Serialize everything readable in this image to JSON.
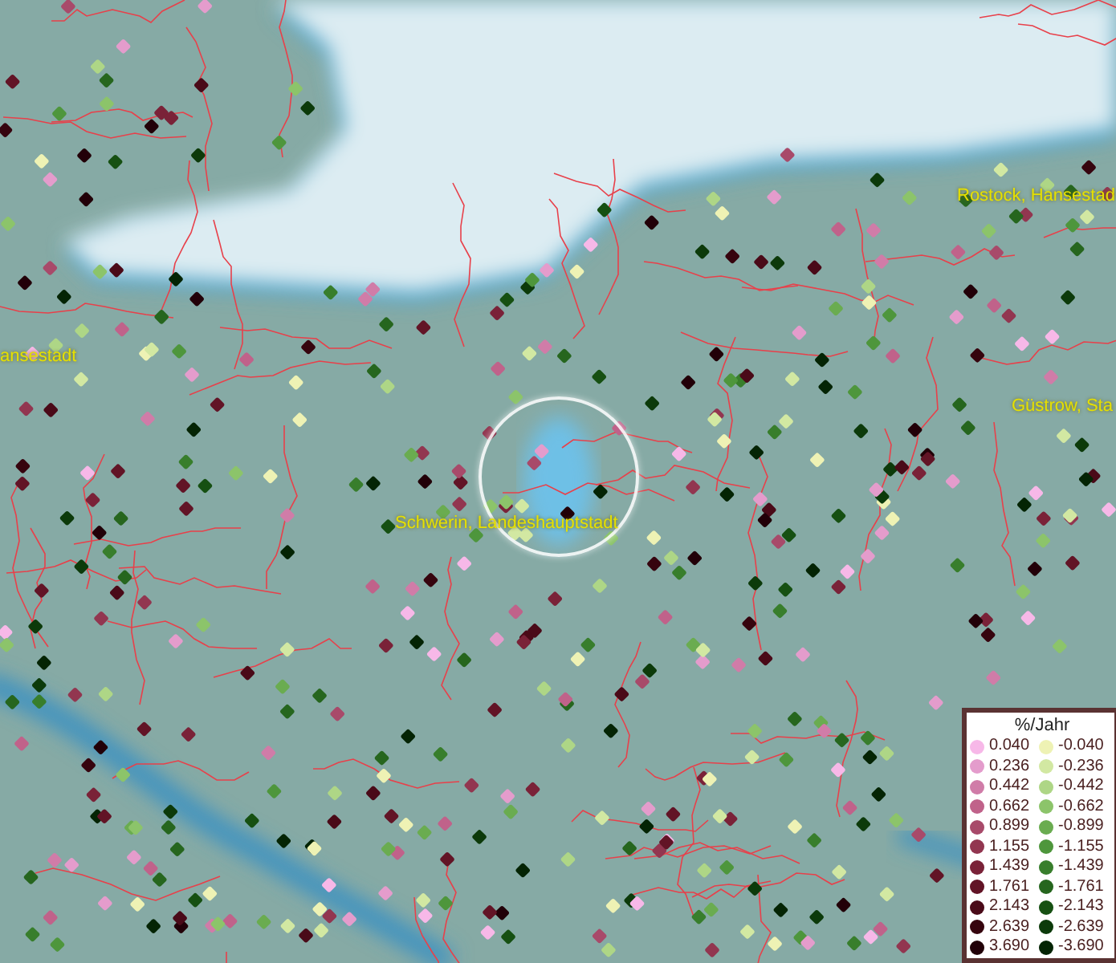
{
  "map": {
    "place_labels": [
      {
        "text": "Rostock, Hansestad"
      },
      {
        "text": "ansestadt"
      },
      {
        "text": "Güstrow, Sta"
      },
      {
        "text": "Schwerin, Landeshauptstadt"
      }
    ]
  },
  "legend": {
    "title": "%/Jahr",
    "columns": [
      [
        {
          "value": "0.040",
          "color": "#f7b8e8"
        },
        {
          "value": "0.236",
          "color": "#e49ccc"
        },
        {
          "value": "0.442",
          "color": "#d07ca8"
        },
        {
          "value": "0.662",
          "color": "#c0628a"
        },
        {
          "value": "0.899",
          "color": "#a84a6a"
        },
        {
          "value": "1.155",
          "color": "#923650"
        },
        {
          "value": "1.439",
          "color": "#7a2238"
        },
        {
          "value": "1.761",
          "color": "#621426"
        },
        {
          "value": "2.143",
          "color": "#4a0a18"
        },
        {
          "value": "2.639",
          "color": "#36040e"
        },
        {
          "value": "3.690",
          "color": "#220008"
        }
      ],
      [
        {
          "value": "-0.040",
          "color": "#eef2b4"
        },
        {
          "value": "-0.236",
          "color": "#d2e8a2"
        },
        {
          "value": "-0.442",
          "color": "#aed686"
        },
        {
          "value": "-0.662",
          "color": "#8cc46a"
        },
        {
          "value": "-0.899",
          "color": "#6aac50"
        },
        {
          "value": "-1.155",
          "color": "#4e963c"
        },
        {
          "value": "-1.439",
          "color": "#387e2c"
        },
        {
          "value": "-1.761",
          "color": "#26661e"
        },
        {
          "value": "-2.143",
          "color": "#165012"
        },
        {
          "value": "-2.639",
          "color": "#0c3a0a"
        },
        {
          "value": "-3.690",
          "color": "#042404"
        }
      ]
    ]
  }
}
